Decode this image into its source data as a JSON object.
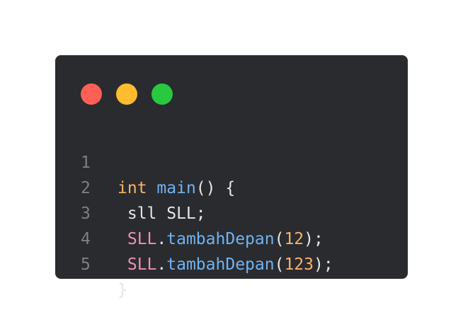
{
  "window": {
    "buttons": {
      "close_color": "#ff5f57",
      "minimize_color": "#febc2e",
      "maximize_color": "#28c840"
    }
  },
  "code": {
    "lines": [
      {
        "number": "1",
        "tokens": [
          {
            "text": "int",
            "kind": "keyword"
          },
          {
            "text": " ",
            "kind": "plain"
          },
          {
            "text": "main",
            "kind": "func"
          },
          {
            "text": "() {",
            "kind": "plain"
          }
        ]
      },
      {
        "number": "2",
        "tokens": [
          {
            "text": " sll SLL;",
            "kind": "plain"
          }
        ]
      },
      {
        "number": "3",
        "tokens": [
          {
            "text": " ",
            "kind": "plain"
          },
          {
            "text": "SLL",
            "kind": "obj"
          },
          {
            "text": ".",
            "kind": "plain"
          },
          {
            "text": "tambahDepan",
            "kind": "func"
          },
          {
            "text": "(",
            "kind": "plain"
          },
          {
            "text": "12",
            "kind": "number"
          },
          {
            "text": ");",
            "kind": "plain"
          }
        ]
      },
      {
        "number": "4",
        "tokens": [
          {
            "text": " ",
            "kind": "plain"
          },
          {
            "text": "SLL",
            "kind": "obj"
          },
          {
            "text": ".",
            "kind": "plain"
          },
          {
            "text": "tambahDepan",
            "kind": "func"
          },
          {
            "text": "(",
            "kind": "plain"
          },
          {
            "text": "123",
            "kind": "number"
          },
          {
            "text": ");",
            "kind": "plain"
          }
        ]
      },
      {
        "number": "5",
        "tokens": [
          {
            "text": "}",
            "kind": "plain"
          }
        ]
      }
    ]
  }
}
